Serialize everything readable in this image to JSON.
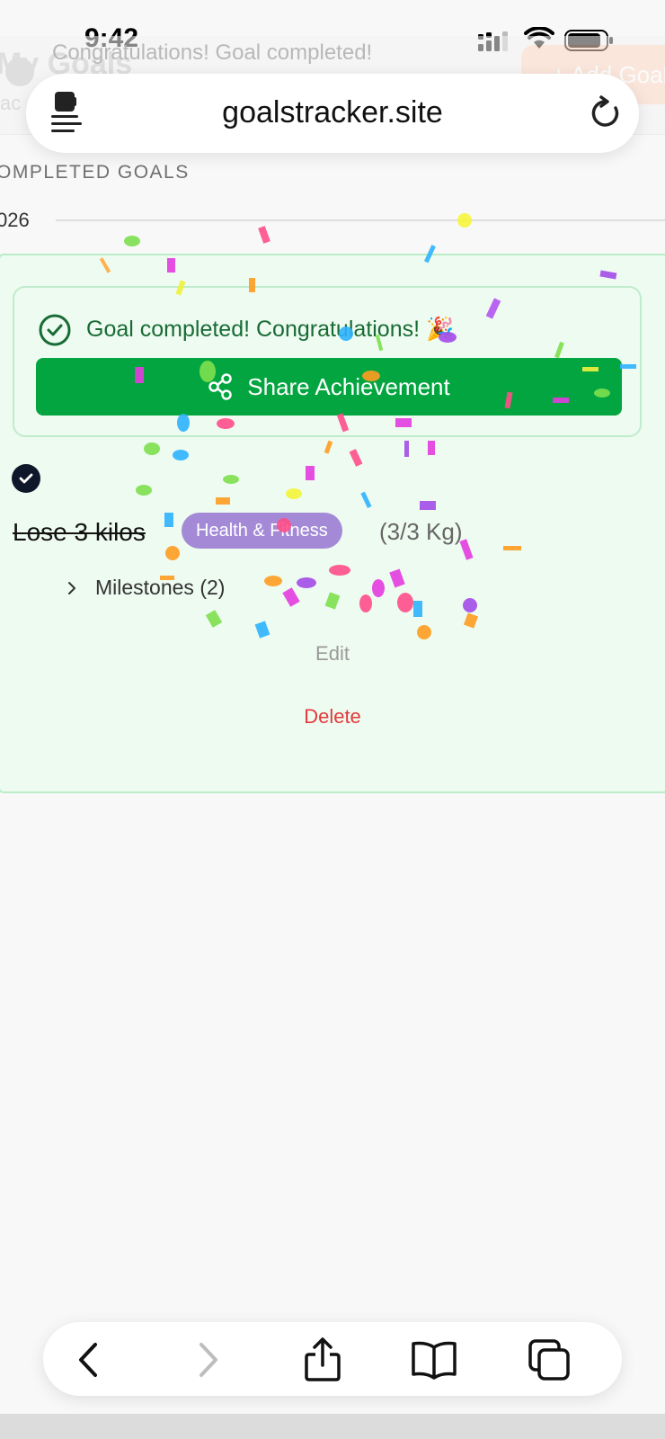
{
  "status_bar": {
    "time": "9:42"
  },
  "background_page": {
    "title": "My Goals",
    "subtitle": "ac",
    "add_button_label": "+ Add Goal",
    "toast": "Congratulations! Goal completed!"
  },
  "browser": {
    "url": "goalstracker.site",
    "icons": [
      "reader-mode-icon",
      "reload-icon"
    ]
  },
  "section": {
    "label": "OMPLETED GOALS",
    "year": "026"
  },
  "goal": {
    "completed_message": "Goal completed! Congratulations! 🎉",
    "share_button_label": "Share Achievement",
    "title": "Lose 3 kilos",
    "category": "Health & Fitness",
    "category_color": "#a48ad6",
    "progress": "(3/3 Kg)",
    "milestones_label": "Milestones (2)",
    "edit_label": "Edit",
    "delete_label": "Delete",
    "accent_color": "#02a53f",
    "completed": true
  },
  "toolbar": {
    "icons": [
      "back-icon",
      "forward-icon",
      "share-icon",
      "bookmarks-icon",
      "tabs-icon"
    ]
  }
}
